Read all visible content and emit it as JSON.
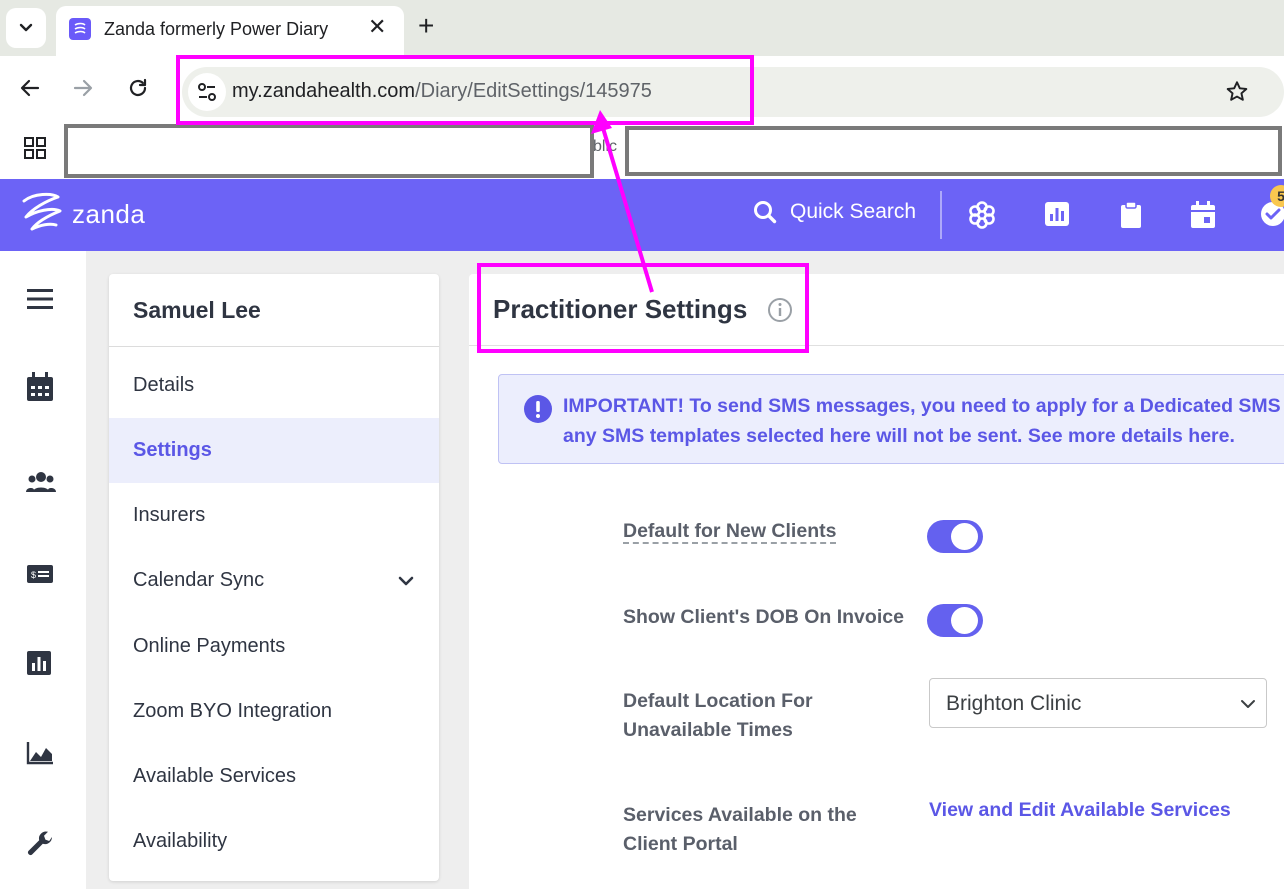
{
  "browser": {
    "tab_title": "Zanda formerly Power Diary",
    "url_host": "my.zandahealth.com",
    "url_path": "/Diary/EditSettings/145975",
    "bookmark_fragment": "blic"
  },
  "app": {
    "logo_text": "zanda",
    "quick_search": "Quick Search",
    "notification_count": "5",
    "accent_color": "#6c63f6"
  },
  "sidebar": {
    "name": "Samuel Lee",
    "items": [
      {
        "label": "Details"
      },
      {
        "label": "Settings"
      },
      {
        "label": "Insurers"
      },
      {
        "label": "Calendar Sync"
      },
      {
        "label": "Online Payments"
      },
      {
        "label": "Zoom BYO Integration"
      },
      {
        "label": "Available Services"
      },
      {
        "label": "Availability"
      }
    ]
  },
  "main": {
    "title": "Practitioner Settings",
    "alert_line1": "IMPORTANT! To send SMS messages, you need to apply for a Dedicated SMS",
    "alert_line2": "any SMS templates selected here will not be sent. See more details here.",
    "settings": {
      "default_new_clients": "Default for New Clients",
      "show_dob": "Show Client's DOB On Invoice",
      "default_location_line1": "Default Location For",
      "default_location_line2": "Unavailable Times",
      "default_location_value": "Brighton Clinic",
      "services_portal_line1": "Services Available on the",
      "services_portal_line2": "Client Portal",
      "services_link": "View and Edit Available Services"
    }
  }
}
